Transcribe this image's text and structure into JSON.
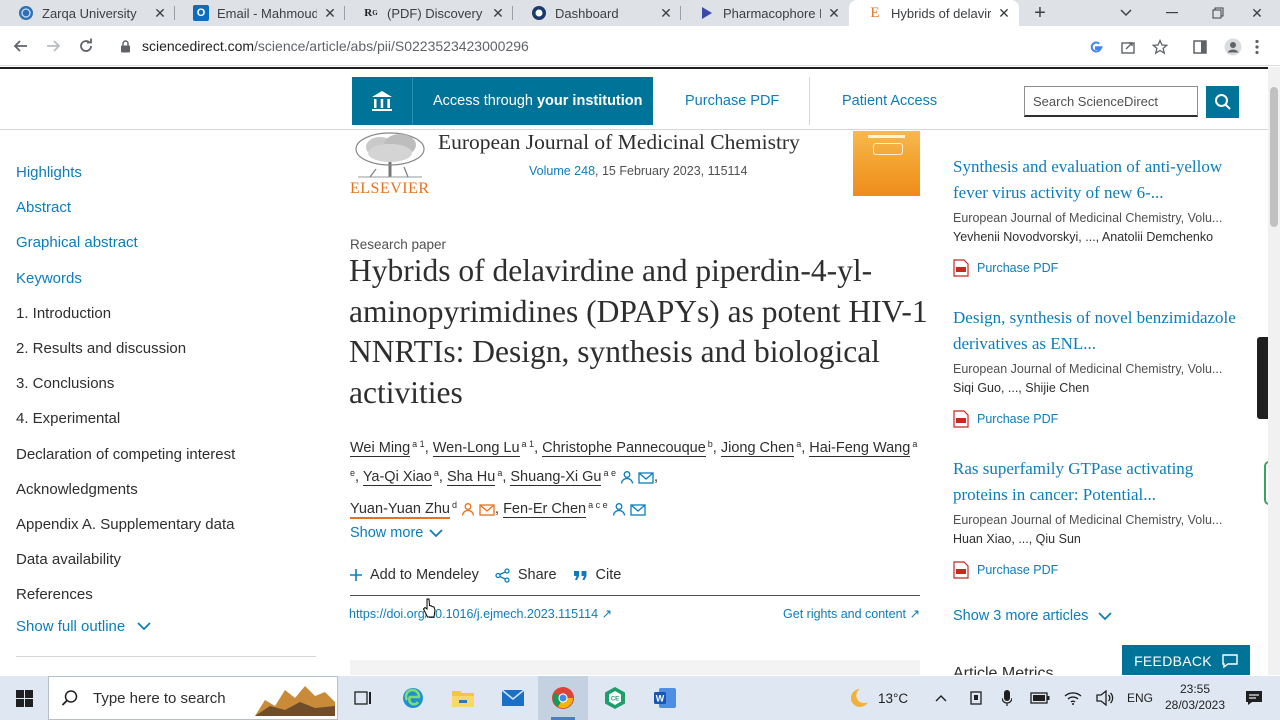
{
  "browser": {
    "tabs": [
      {
        "title": "Zarqa University",
        "favicon": "globe-icon"
      },
      {
        "title": "Email - Mahmoud S",
        "favicon": "outlook-icon"
      },
      {
        "title": "(PDF) Discovery of",
        "favicon": "researchgate-icon"
      },
      {
        "title": "Dashboard",
        "favicon": "moodle-icon"
      },
      {
        "title": "Pharmacophore Ma",
        "favicon": "play-icon"
      },
      {
        "title": "Hybrids of delavird",
        "favicon": "elsevier-icon",
        "active": true
      }
    ],
    "url_host": "sciencedirect.com",
    "url_path": "/science/article/abs/pii/S0223523423000296"
  },
  "header": {
    "access_prefix": "Access through ",
    "access_bold": "your institution",
    "purchase_pdf": "Purchase PDF",
    "patient_access": "Patient Access",
    "search_placeholder": "Search ScienceDirect"
  },
  "outline": {
    "items": [
      {
        "label": "Highlights",
        "link": true
      },
      {
        "label": "Abstract",
        "link": true
      },
      {
        "label": "Graphical abstract",
        "link": true
      },
      {
        "label": "Keywords",
        "link": true
      },
      {
        "label": "1. Introduction",
        "link": false
      },
      {
        "label": "2. Results and discussion",
        "link": false
      },
      {
        "label": "3. Conclusions",
        "link": false
      },
      {
        "label": "4. Experimental",
        "link": false
      },
      {
        "label": "Declaration of competing interest",
        "link": false
      },
      {
        "label": "Acknowledgments",
        "link": false
      },
      {
        "label": "Appendix A. Supplementary data",
        "link": false
      },
      {
        "label": "Data availability",
        "link": false
      },
      {
        "label": "References",
        "link": false
      }
    ],
    "show_full": "Show full outline"
  },
  "journal": {
    "publisher": "ELSEVIER",
    "name": "European Journal of Medicinal Chemistry",
    "volume": "Volume 248",
    "issue_rest": ", 15 February 2023, 115114"
  },
  "article": {
    "type": "Research paper",
    "title": "Hybrids of delavirdine and piperdin-4-yl-aminopyrimidines (DPAPYs) as potent HIV-1 NNRTIs: Design, synthesis and biological activities",
    "authors": [
      {
        "name": "Wei Ming",
        "sup": "a 1"
      },
      {
        "name": "Wen-Long Lu",
        "sup": "a 1"
      },
      {
        "name": "Christophe Pannecouque",
        "sup": "b"
      },
      {
        "name": "Jiong Chen",
        "sup": "a"
      },
      {
        "name": "Hai-Feng Wang",
        "sup": "a e"
      },
      {
        "name": "Ya-Qi Xiao",
        "sup": "a"
      },
      {
        "name": "Sha Hu",
        "sup": "a"
      },
      {
        "name": "Shuang-Xi Gu",
        "sup": "a e"
      },
      {
        "name": "Yuan-Yuan Zhu",
        "sup": "d"
      },
      {
        "name": "Fen-Er Chen",
        "sup": "a c e"
      }
    ],
    "show_more": "Show more",
    "add_mendeley": "Add to Mendeley",
    "share": "Share",
    "cite": "Cite",
    "doi": "https://doi.org/10.1016/j.ejmech.2023.115114",
    "rights": "Get rights and content"
  },
  "recommended": [
    {
      "title": "Synthesis and evaluation of anti-yellow fever virus activity of new 6-...",
      "journal": "European Journal of Medicinal Chemistry, Volu...",
      "authors": "Yevhenii Novodvorskyi, ..., Anatolii Demchenko",
      "pdf": "Purchase PDF"
    },
    {
      "title": "Design, synthesis of novel benzimidazole derivatives as ENL...",
      "journal": "European Journal of Medicinal Chemistry, Volu...",
      "authors": "Siqi Guo, ..., Shijie Chen",
      "pdf": "Purchase PDF"
    },
    {
      "title": "Ras superfamily GTPase activating proteins in cancer: Potential...",
      "journal": "European Journal of Medicinal Chemistry, Volu...",
      "authors": "Huan Xiao, ..., Qiu Sun",
      "pdf": "Purchase PDF"
    }
  ],
  "right_rail": {
    "show_more_articles": "Show 3 more articles",
    "metrics_peek": "Article Metrics",
    "feedback": "FEEDBACK"
  },
  "taskbar": {
    "search_placeholder": "Type here to search",
    "weather": "13°C",
    "language": "ENG",
    "time": "23:55",
    "date": "28/03/2023"
  },
  "colors": {
    "brand_blue": "#007398",
    "link_blue": "#0c7dbb",
    "elsevier_orange": "#e9711c"
  }
}
